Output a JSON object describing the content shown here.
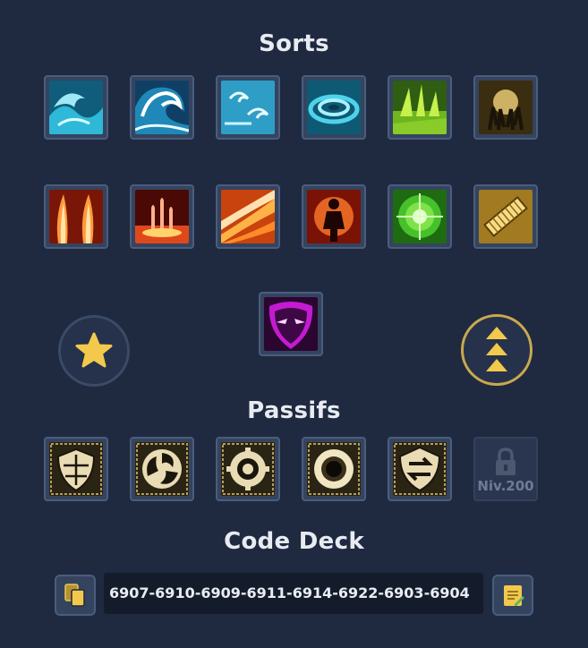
{
  "sections": {
    "spells_title": "Sorts",
    "passives_title": "Passifs",
    "deck_title": "Code Deck"
  },
  "spells": {
    "row1": [
      "water-wave-icon",
      "tidal-wave-icon",
      "water-swirl-icon",
      "whirlpool-icon",
      "nature-spikes-icon",
      "golden-hands-icon"
    ],
    "row2": [
      "fire-pillars-icon",
      "fire-rain-icon",
      "flame-wave-icon",
      "fire-figure-icon",
      "green-target-icon",
      "golden-scroll-icon"
    ],
    "special": "pink-mask-icon"
  },
  "passives": {
    "icons": [
      "shield-passive-icon",
      "swirl-passive-icon",
      "gear-passive-icon",
      "eclipse-passive-icon",
      "exchange-passive-icon"
    ],
    "locked_level": "Niv.200"
  },
  "buttons": {
    "favorite": "star-icon",
    "level_up": "triple-arrow-up-icon"
  },
  "deck": {
    "code": "6907-6910-6909-6911-6914-6922-6903-6904"
  },
  "colors": {
    "background": "#1f2a40",
    "slot_border": "#4b5d7d",
    "gold": "#f2c94c"
  }
}
